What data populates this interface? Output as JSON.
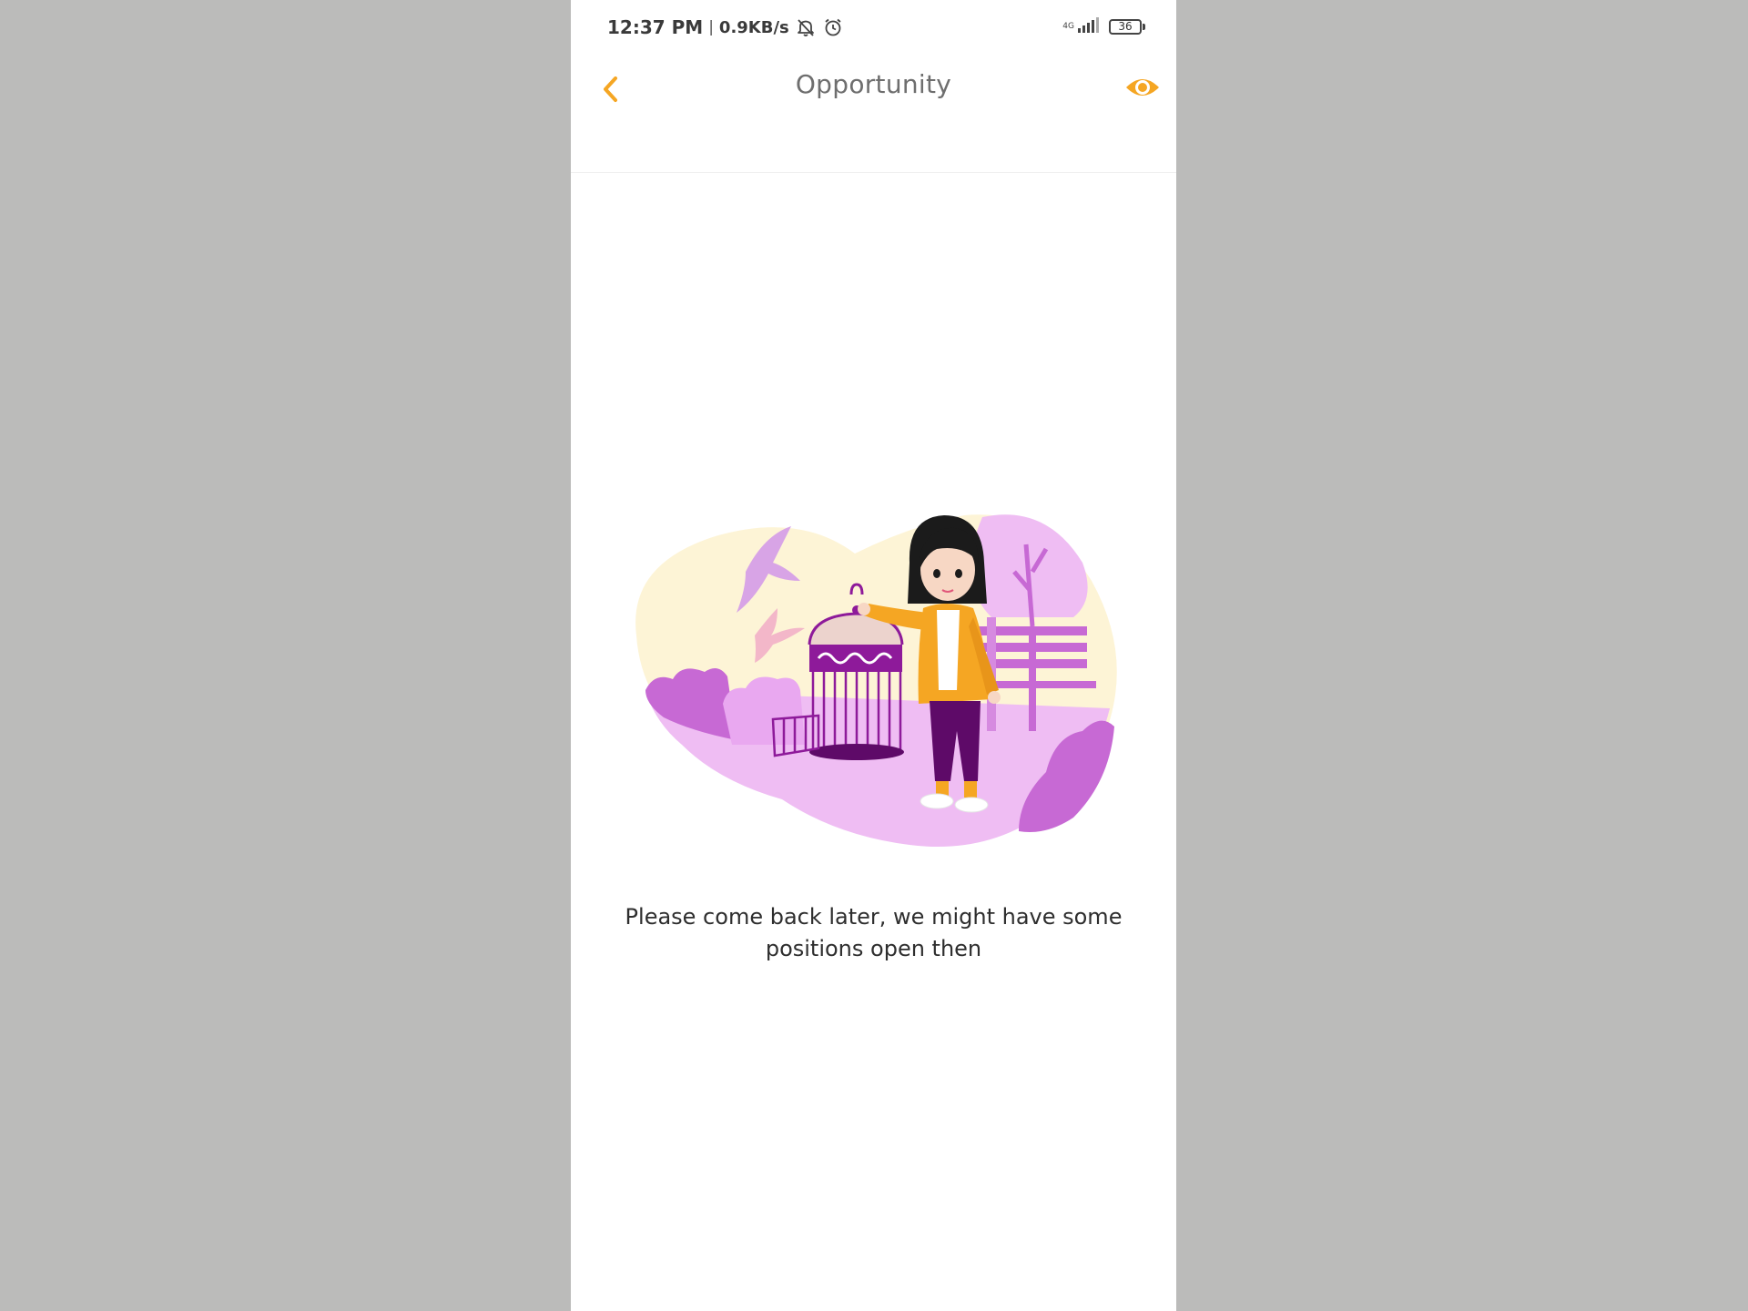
{
  "status_bar": {
    "time": "12:37 PM",
    "separator": "|",
    "net_speed": "0.9KB/s",
    "network_type": "4G",
    "battery_level": "36",
    "icons": [
      "mute-icon",
      "alarm-icon",
      "signal-icon",
      "battery-icon"
    ]
  },
  "header": {
    "title": "Opportunity",
    "back_icon": "chevron-left-icon",
    "view_icon": "eye-icon",
    "accent_color": "#f5a623"
  },
  "empty_state": {
    "illustration": "girl-releasing-birds-from-cage",
    "message": "Please come back later, we might have some positions open then"
  },
  "colors": {
    "accent": "#f5a623",
    "title_text": "#6e6e6e",
    "body_text": "#2e2e2e",
    "purple": "#8e1a9a",
    "lavender": "#efbdf3",
    "cream": "#fdf4d6"
  }
}
